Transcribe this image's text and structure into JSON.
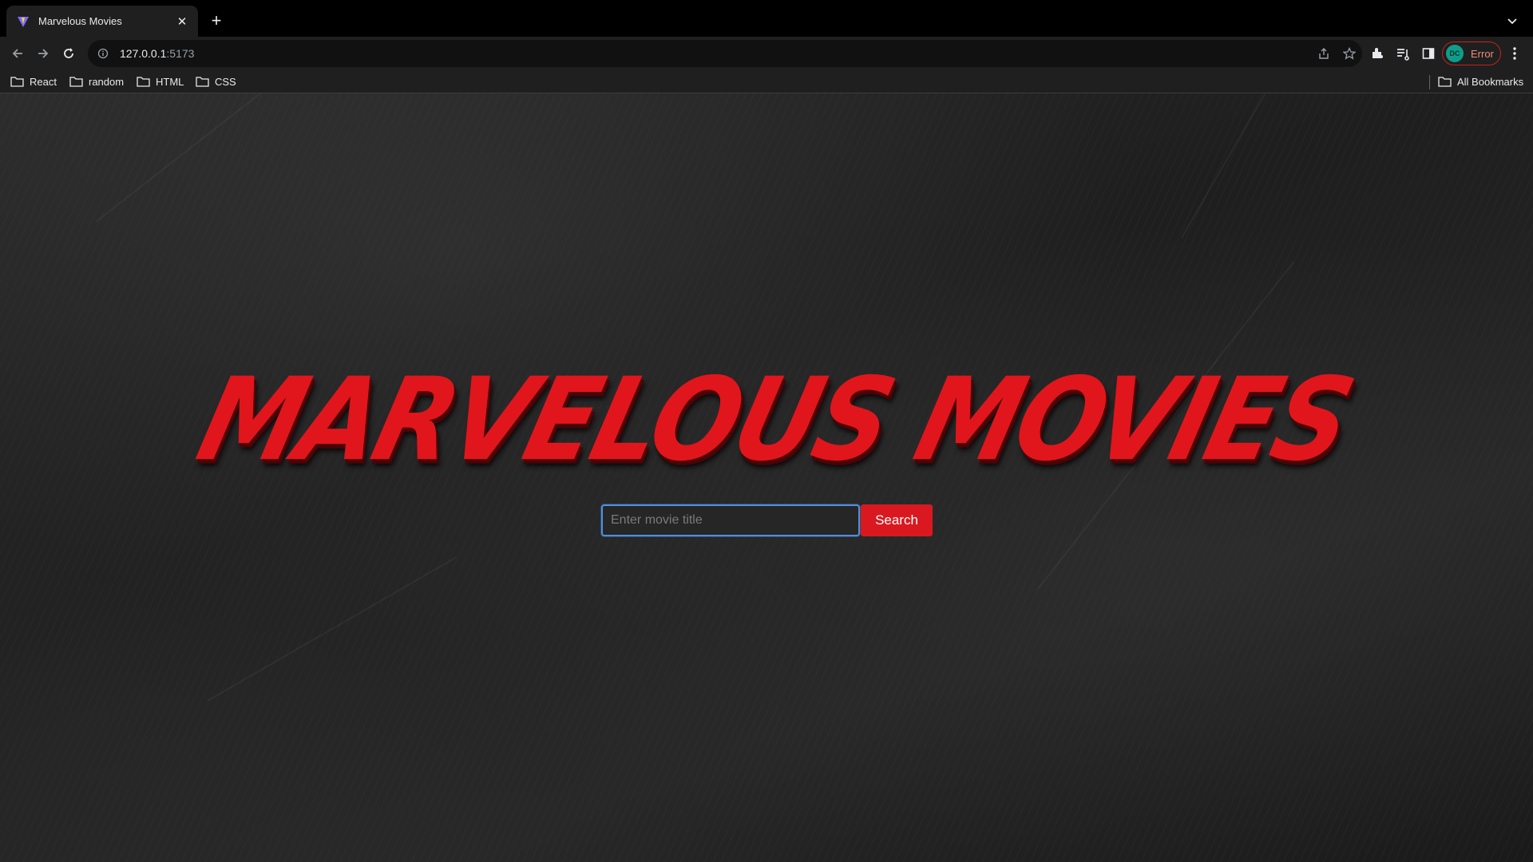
{
  "browser": {
    "tab": {
      "title": "Marvelous Movies",
      "favicon": "vite-favicon"
    },
    "new_tab_label": "+",
    "url": {
      "host": "127.0.0.1",
      "port": ":5173"
    },
    "profile": {
      "initials": "DC",
      "status": "Error"
    },
    "bookmarks": [
      {
        "label": "React"
      },
      {
        "label": "random"
      },
      {
        "label": "HTML"
      },
      {
        "label": "CSS"
      }
    ],
    "all_bookmarks_label": "All Bookmarks"
  },
  "page": {
    "logo_text": "MARVELOUS MOVIES",
    "search": {
      "placeholder": "Enter movie title",
      "value": "",
      "button_label": "Search"
    }
  },
  "colors": {
    "accent": "#d9191f",
    "logo_red": "#e0161c",
    "focus_ring": "#4e8fe0",
    "profile_error": "#c5221f"
  }
}
